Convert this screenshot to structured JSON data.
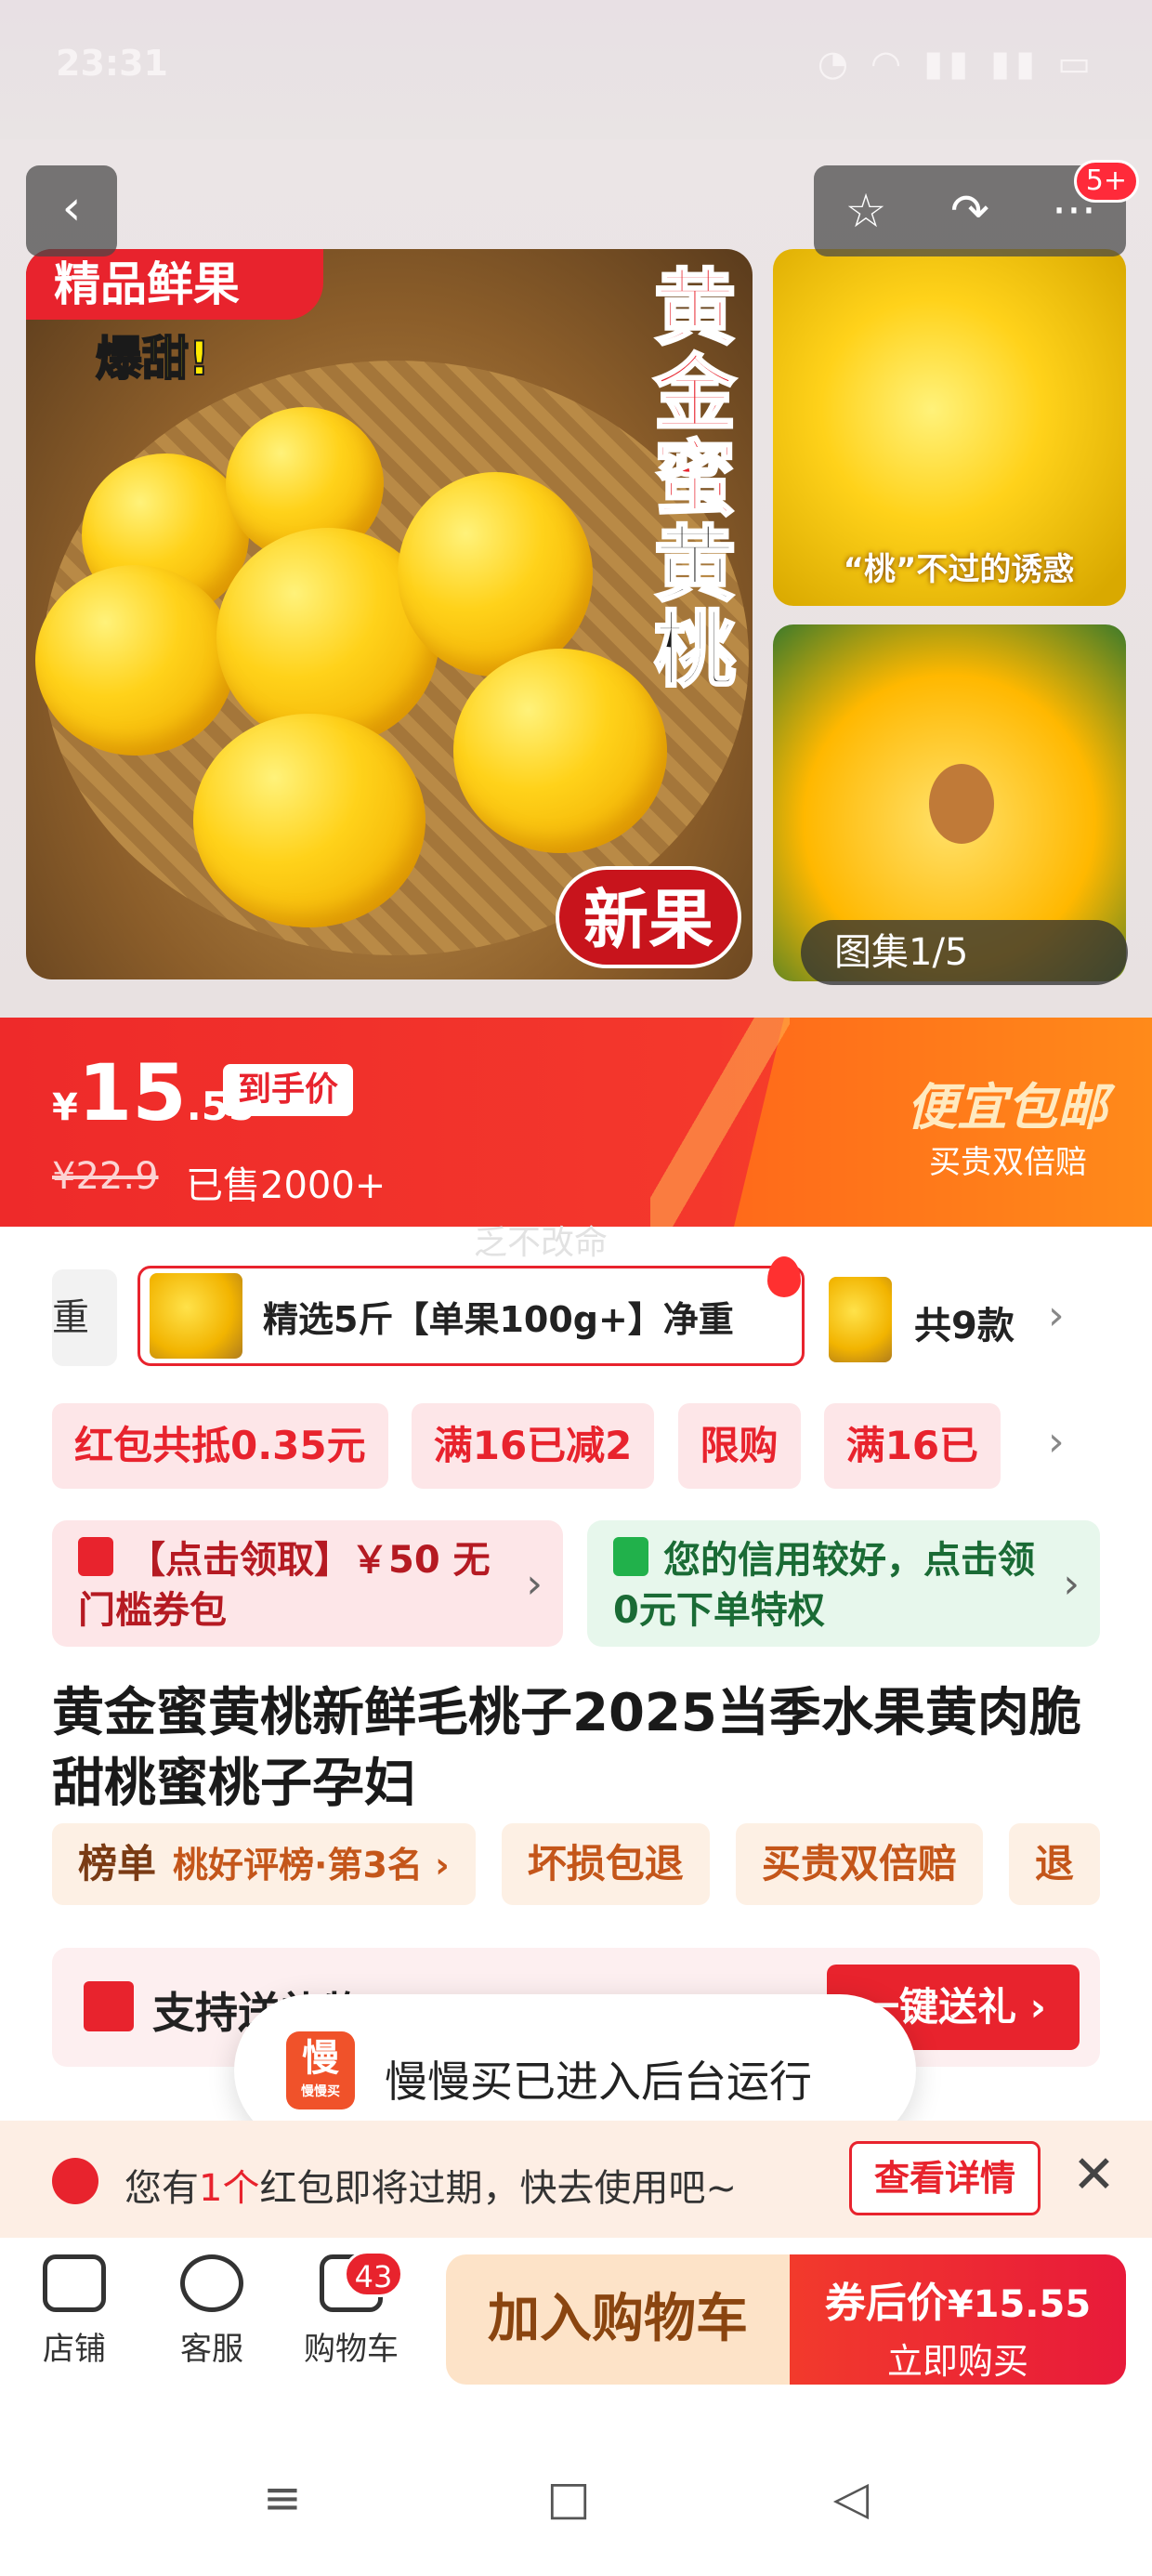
{
  "status_bar": {
    "time": "23:31",
    "icons": "◔ ◠ ▮▮ ▮▮ ▭"
  },
  "gallery": {
    "back_icon": "‹",
    "actions": [
      "☆",
      "↷",
      "···"
    ],
    "message_badge": "5+",
    "main_photo": {
      "tag": "精品鲜果",
      "tag2": "爆甜!",
      "vertical_title_red": "黄金蜜",
      "vertical_title_black": "黄桃",
      "new_badge": "新果"
    },
    "thumb1_caption": "“桃”不过的诱惑",
    "counter": "图集1/5"
  },
  "price": {
    "currency": "¥",
    "integer": "15",
    "decimal": ".55",
    "tag": "到手价",
    "original": "¥22.9",
    "sold": "已售2000+",
    "promo_title": "便宜包邮",
    "promo_sub": "买贵双倍赔"
  },
  "watermark": "乏不改命",
  "sku": {
    "prev": "重",
    "selected": "精选5斤【单果100g+】净重",
    "count": "共9款",
    "arrow": "›"
  },
  "coupons": {
    "chips": [
      "红包共抵0.35元",
      "满16已减2",
      "限购",
      "满16已"
    ],
    "arrow": "›"
  },
  "cards": {
    "left": "【点击领取】￥50 无门槛券包",
    "right": "您的信用较好，点击领0元下单特权",
    "chevron": "›"
  },
  "title": "黄金蜜黄桃新鲜毛桃子2025当季水果黄肉脆甜桃蜜桃子孕妇",
  "badges": {
    "rank_label": "榜单",
    "rank_text": "桃好评榜·第3名 ›",
    "items": [
      "坏损包退",
      "买贵双倍赔",
      "退"
    ]
  },
  "gift": {
    "text": "支持送礼物",
    "button": "一键送礼 ›"
  },
  "toast": {
    "logo": "慢",
    "logo_sub": "慢慢买",
    "text": "慢慢买已进入后台运行"
  },
  "notice": {
    "pre": "您有",
    "highlight": "1个",
    "post": "红包即将过期，快去使用吧~",
    "button": "查看详情",
    "close": "✕"
  },
  "bottom_bar": {
    "store": "店铺",
    "service": "客服",
    "cart": "购物车",
    "cart_badge": "43",
    "add_cart": "加入购物车",
    "buy_line1": "券后价",
    "buy_price": "¥15.55",
    "buy_line2": "立即购买"
  },
  "sys_nav": {
    "menu": "≡",
    "home": "□",
    "back": "◁"
  },
  "colors": {
    "brand_red": "#e8232d",
    "promo_orange": "#ff6a1a",
    "green": "#21b14b"
  }
}
